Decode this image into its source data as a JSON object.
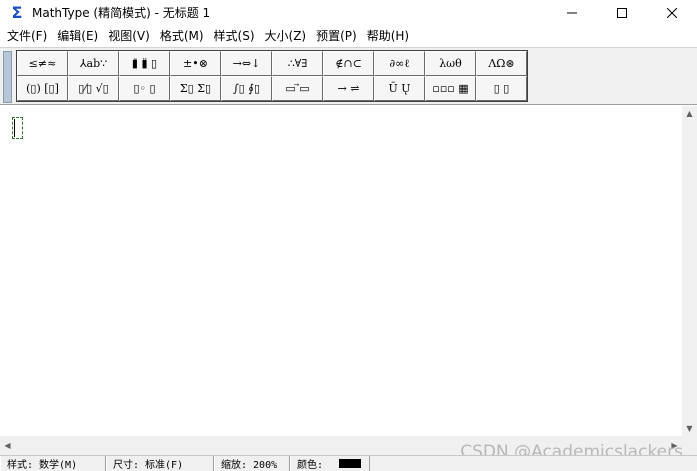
{
  "window": {
    "title": "MathType (精简模式) - 无标题 1",
    "app_icon": "sigma-icon",
    "controls": [
      "minimize-icon",
      "maximize-icon",
      "close-icon"
    ]
  },
  "menu": {
    "items": [
      "文件(F)",
      "编辑(E)",
      "视图(V)",
      "格式(M)",
      "样式(S)",
      "大小(Z)",
      "预置(P)",
      "帮助(H)"
    ]
  },
  "palette": {
    "row1": [
      "≤≠≈",
      "⅄ab∵",
      "▮̄ ▮̈ ▯",
      "±•⊗",
      "→⇔↓",
      "∴∀∃",
      "∉∩⊂",
      "∂∞ℓ",
      "λωθ",
      "ΛΩ⊛"
    ],
    "row2": [
      "(▯) [▯]",
      "▯⁄▯ √▯",
      "▯◦ ▯",
      "Σ▯ Σ▯",
      "∫▯ ∮▯",
      "▭ ⃗▭",
      "→ ⇌",
      "Ū Ų",
      "▫▫▫ ▦",
      "▯ ▯"
    ]
  },
  "status": {
    "style": "样式: 数学(M)",
    "size": "尺寸: 标准(F)",
    "zoom": "缩放: 200%",
    "color_label": "颜色:",
    "color_value": "#000000"
  },
  "watermark": "CSDN @Academicslackers"
}
